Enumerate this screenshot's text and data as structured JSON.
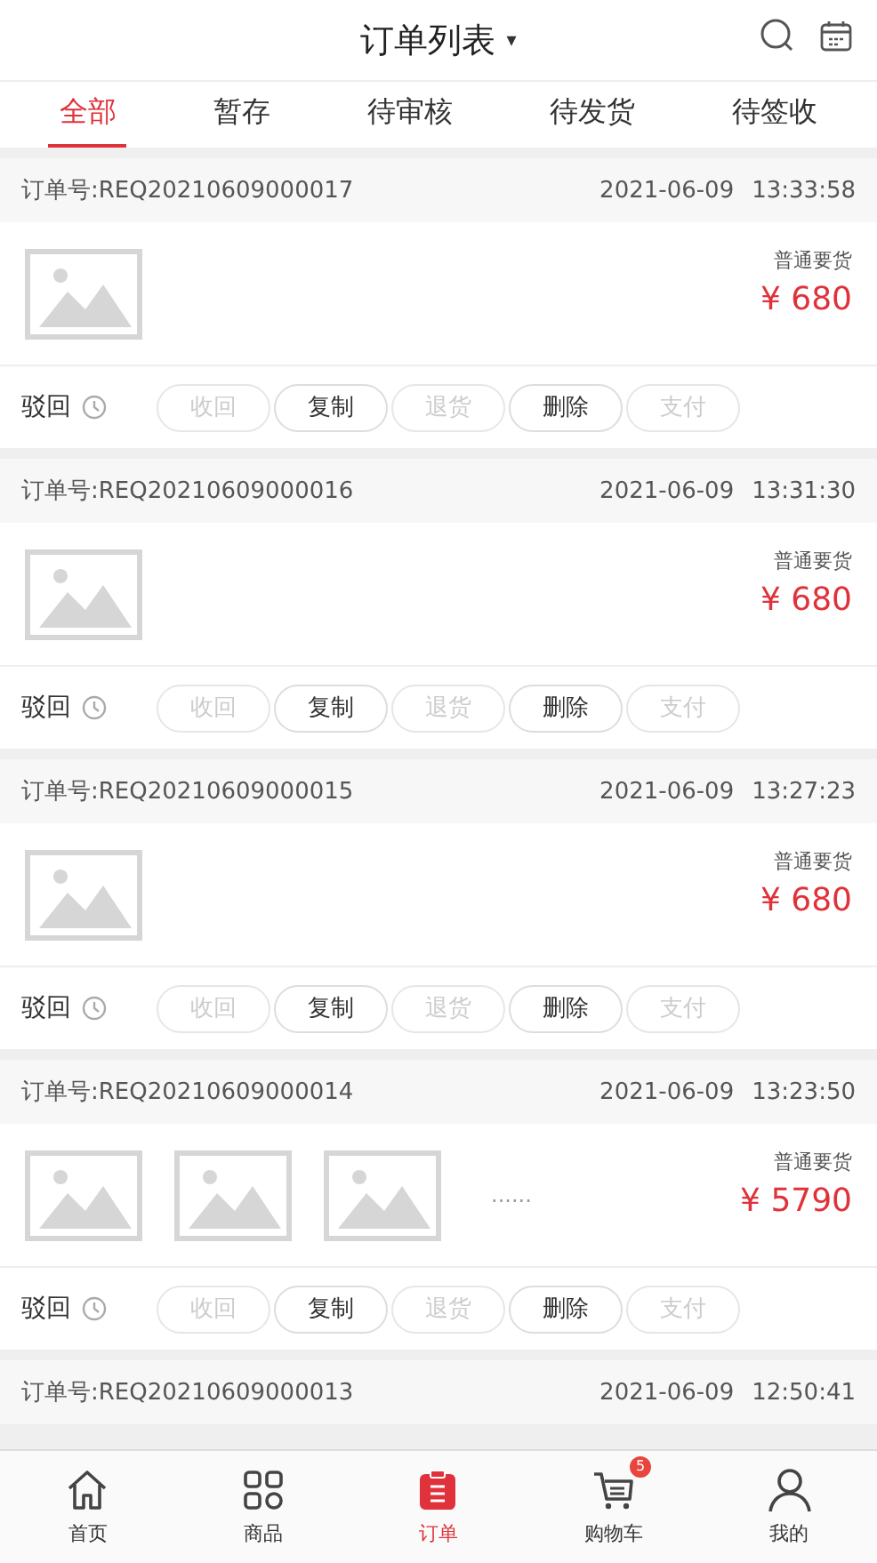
{
  "header": {
    "title": "订单列表",
    "dropdown": "▾"
  },
  "tabs": [
    {
      "label": "全部",
      "selected": true
    },
    {
      "label": "暂存",
      "selected": false
    },
    {
      "label": "待审核",
      "selected": false
    },
    {
      "label": "待发货",
      "selected": false
    },
    {
      "label": "待签收",
      "selected": false
    }
  ],
  "orders": [
    {
      "number": "订单号:REQ20210609000017",
      "date": "2021-06-09",
      "time": "13:33:58",
      "type": "普通要货",
      "price": "¥ 680",
      "status": "驳回",
      "actions": [
        {
          "label": "收回",
          "disabled": true
        },
        {
          "label": "复制",
          "disabled": false
        },
        {
          "label": "退货",
          "disabled": true
        },
        {
          "label": "删除",
          "disabled": false
        },
        {
          "label": "支付",
          "disabled": true
        }
      ]
    },
    {
      "number": "订单号:REQ20210609000016",
      "date": "2021-06-09",
      "time": "13:31:30",
      "type": "普通要货",
      "price": "¥ 680",
      "status": "驳回",
      "actions": [
        {
          "label": "收回",
          "disabled": true
        },
        {
          "label": "复制",
          "disabled": false
        },
        {
          "label": "退货",
          "disabled": true
        },
        {
          "label": "删除",
          "disabled": false
        },
        {
          "label": "支付",
          "disabled": true
        }
      ]
    },
    {
      "number": "订单号:REQ20210609000015",
      "date": "2021-06-09",
      "time": "13:27:23",
      "type": "普通要货",
      "price": "¥ 680",
      "status": "驳回",
      "actions": [
        {
          "label": "收回",
          "disabled": true
        },
        {
          "label": "复制",
          "disabled": false
        },
        {
          "label": "退货",
          "disabled": true
        },
        {
          "label": "删除",
          "disabled": false
        },
        {
          "label": "支付",
          "disabled": true
        }
      ]
    },
    {
      "number": "订单号:REQ20210609000014",
      "date": "2021-06-09",
      "time": "13:23:50",
      "more_text": "......",
      "type": "普通要货",
      "price": "¥ 5790",
      "status": "驳回",
      "actions": [
        {
          "label": "收回",
          "disabled": true
        },
        {
          "label": "复制",
          "disabled": false
        },
        {
          "label": "退货",
          "disabled": true
        },
        {
          "label": "删除",
          "disabled": false
        },
        {
          "label": "支付",
          "disabled": true
        }
      ]
    },
    {
      "number": "订单号:REQ20210609000013",
      "date": "2021-06-09",
      "time": "12:50:41"
    }
  ],
  "nav": [
    {
      "label": "首页",
      "kind": "home",
      "selected": false
    },
    {
      "label": "商品",
      "kind": "grid",
      "selected": false
    },
    {
      "label": "订单",
      "kind": "order",
      "selected": true
    },
    {
      "label": "购物车",
      "kind": "cart",
      "selected": false,
      "badge": "5"
    },
    {
      "label": "我的",
      "kind": "user",
      "selected": false
    }
  ]
}
